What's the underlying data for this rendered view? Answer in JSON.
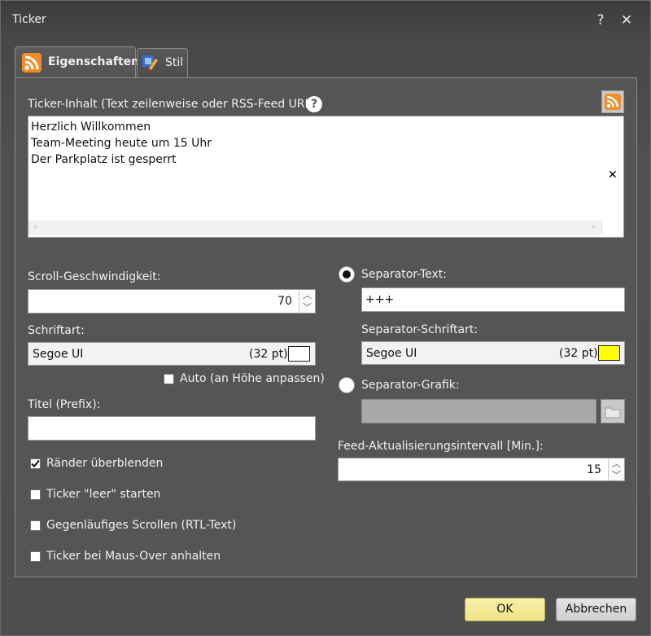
{
  "window": {
    "title": "Ticker",
    "help_label": "?",
    "close_label": "✕"
  },
  "tabs": [
    {
      "label": "Eigenschaften",
      "icon": "rss-icon"
    },
    {
      "label": "Stil",
      "icon": "style-brush-icon"
    }
  ],
  "content": {
    "label": "Ticker-Inhalt (Text zeilenweise oder RSS-Feed URL):",
    "help_label": "?",
    "lines": [
      "Herzlich Willkommen",
      "Team-Meeting heute um 15 Uhr",
      "Der Parkplatz ist gesperrt"
    ],
    "clear_label": "✕"
  },
  "speed": {
    "label": "Scroll-Geschwindigkeit:",
    "value": "70"
  },
  "font": {
    "label": "Schriftart:",
    "name": "Segoe UI",
    "size": "(32 pt)",
    "color": "#ffffff"
  },
  "auto_height": {
    "label": "Auto (an Höhe anpassen)",
    "checked": false
  },
  "title_prefix": {
    "label": "Titel (Prefix):",
    "value": ""
  },
  "options": [
    {
      "label": "Ränder überblenden",
      "checked": true
    },
    {
      "label": "Ticker \"leer\" starten",
      "checked": false
    },
    {
      "label": "Gegenläufiges Scrollen (RTL-Text)",
      "checked": false
    },
    {
      "label": "Ticker bei Maus-Over anhalten",
      "checked": false
    }
  ],
  "separator_text": {
    "label": "Separator-Text:",
    "selected": true,
    "value": "+++"
  },
  "separator_font": {
    "label": "Separator-Schriftart:",
    "name": "Segoe UI",
    "size": "(32 pt)",
    "color": "#ffff00"
  },
  "separator_graphic": {
    "label": "Separator-Grafik:",
    "selected": false
  },
  "feed_interval": {
    "label": "Feed-Aktualisierungsintervall [Min.]:",
    "value": "15"
  },
  "buttons": {
    "ok": "OK",
    "cancel": "Abbrechen"
  },
  "colors": {
    "ok_button": "#f4eb9a",
    "rss_orange": "#f28c28"
  }
}
